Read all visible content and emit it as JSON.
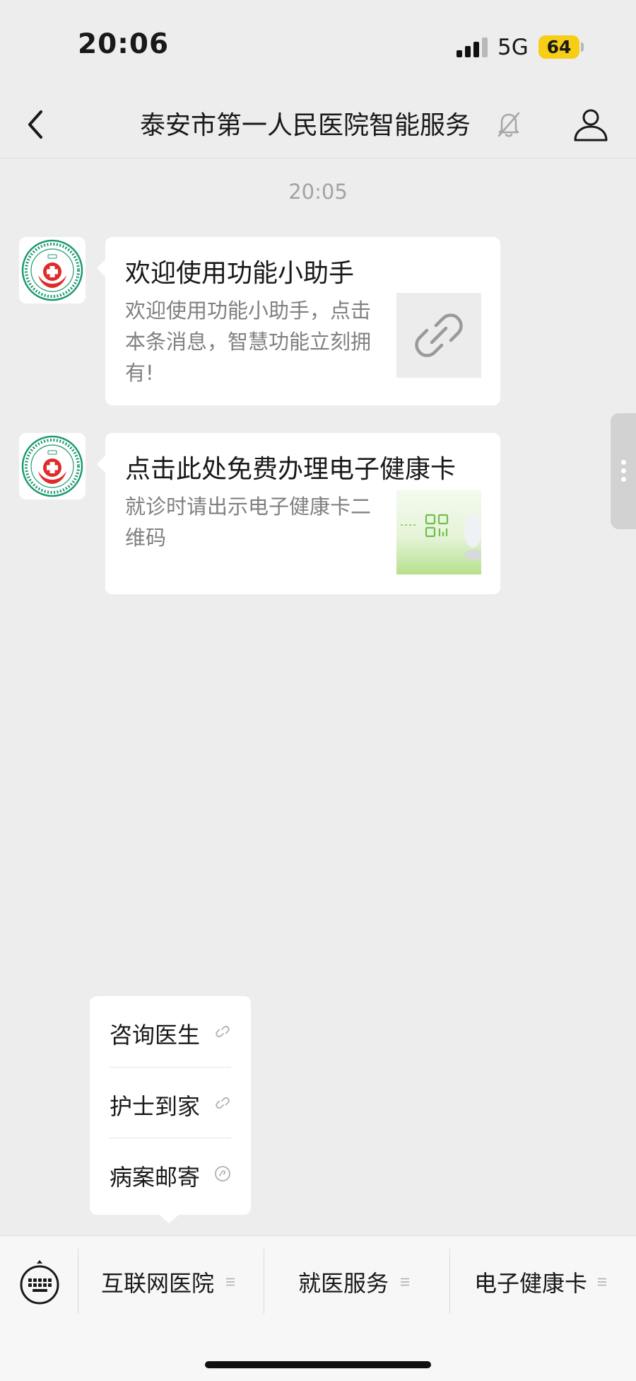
{
  "status_bar": {
    "time": "20:06",
    "network": "5G",
    "battery": "64",
    "signal_bars_active": 3,
    "signal_bars_total": 4
  },
  "nav": {
    "title": "泰安市第一人民医院智能服务",
    "back_icon": "chevron-left-icon",
    "mute_icon": "bell-off-icon",
    "profile_icon": "person-icon"
  },
  "chat": {
    "timestamp": "20:05",
    "messages": [
      {
        "title": "欢迎使用功能小助手",
        "description": "欢迎使用功能小助手，点击本条消息，智慧功能立刻拥有!",
        "thumbnail_icon": "link-icon"
      },
      {
        "title": "点击此处免费办理电子健康卡",
        "description": "就诊时请出示电子健康卡二维码",
        "thumbnail_icon": "qr-code-icon"
      }
    ]
  },
  "popup_menu": {
    "items": [
      {
        "label": "咨询医生",
        "icon": "link-icon"
      },
      {
        "label": "护士到家",
        "icon": "link-icon"
      },
      {
        "label": "病案邮寄",
        "icon": "mini-program-icon"
      }
    ]
  },
  "bottom_menu": {
    "keyboard_icon": "keyboard-icon",
    "tabs": [
      {
        "label": "互联网医院",
        "icon": "menu-lines-icon"
      },
      {
        "label": "就医服务",
        "icon": "menu-lines-icon"
      },
      {
        "label": "电子健康卡",
        "icon": "menu-lines-icon"
      }
    ]
  },
  "colors": {
    "background": "#ededed",
    "card": "#ffffff",
    "battery": "#f6ce16",
    "logo_green": "#1c9a70",
    "logo_red": "#e02b2b",
    "muted_text": "#808080"
  }
}
